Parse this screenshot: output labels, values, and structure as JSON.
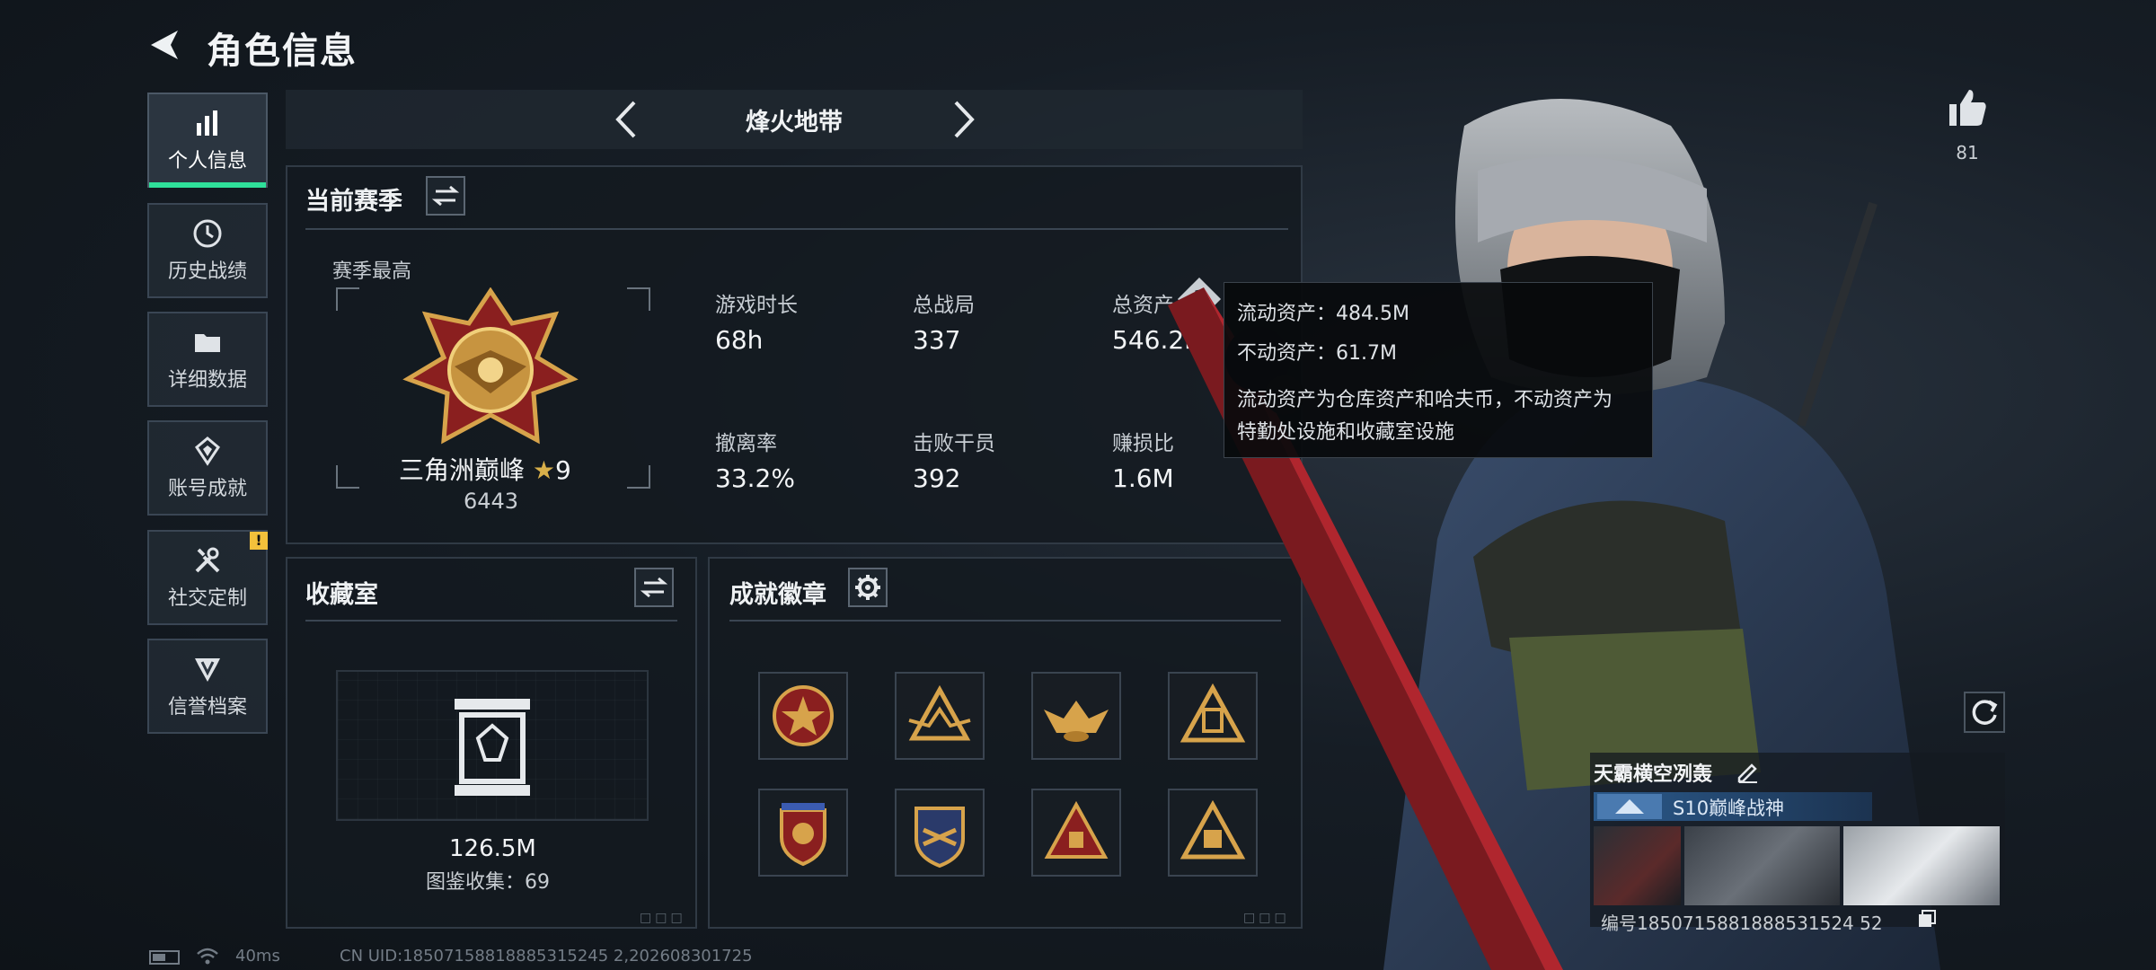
{
  "header": {
    "title": "角色信息"
  },
  "nav": {
    "items": [
      {
        "label": "个人信息",
        "icon": "bar-chart-icon",
        "active": true
      },
      {
        "label": "历史战绩",
        "icon": "clock-icon"
      },
      {
        "label": "详细数据",
        "icon": "folder-icon"
      },
      {
        "label": "账号成就",
        "icon": "achievement-icon"
      },
      {
        "label": "社交定制",
        "icon": "tools-icon",
        "alert": "!"
      },
      {
        "label": "信誉档案",
        "icon": "shield-icon"
      }
    ]
  },
  "mode": {
    "label": "烽火地带"
  },
  "season": {
    "title": "当前赛季",
    "best_label": "赛季最高",
    "rank_name": "三角洲巅峰",
    "rank_star_level": "9",
    "rank_points": "6443",
    "stats": [
      {
        "label": "游戏时长",
        "value": "68h"
      },
      {
        "label": "总战局",
        "value": "337"
      },
      {
        "label": "总资产",
        "value": "546.2M"
      },
      {
        "label": "撤离率",
        "value": "33.2%"
      },
      {
        "label": "击败干员",
        "value": "392"
      },
      {
        "label": "赚损比",
        "value": "1.6M"
      }
    ],
    "help_icon_label": "?"
  },
  "tooltip": {
    "liquid": "流动资产：484.5M",
    "fixed": "不动资产：61.7M",
    "desc_line1": "流动资产为仓库资产和哈夫币，不动资产为",
    "desc_line2": "特勤处设施和收藏室设施"
  },
  "collection": {
    "title": "收藏室",
    "value": "126.5M",
    "count_label": "图鉴收集：69"
  },
  "achievements": {
    "title": "成就徽章",
    "badges": [
      "star-badge",
      "winged-badge",
      "eagle-badge",
      "triangle-badge",
      "shield-star-badge",
      "crest-badge",
      "pyramid-badge",
      "triangle-sign-badge"
    ]
  },
  "profile": {
    "likes": "81",
    "card_name": "天霸横空冽轰",
    "card_subtitle": "S10巅峰战神",
    "id_line": "编号1850715881888531524 52"
  },
  "footer": {
    "latency": "40ms",
    "uid": "CN UID:18507158818885315245 2,202608301725"
  },
  "colors": {
    "accent": "#2fe09a",
    "panel_border": "#303a45",
    "alert": "#f3c13b"
  }
}
